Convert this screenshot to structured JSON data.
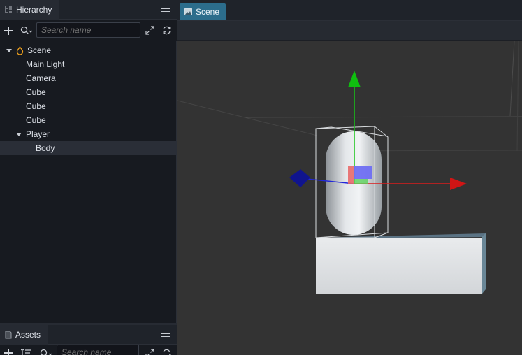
{
  "hierarchy": {
    "tab_label": "Hierarchy",
    "search_placeholder": "Search name",
    "tree": [
      {
        "label": "Scene",
        "depth": 0,
        "expanded": true,
        "icon": "scene-icon"
      },
      {
        "label": "Main Light",
        "depth": 1
      },
      {
        "label": "Camera",
        "depth": 1
      },
      {
        "label": "Cube",
        "depth": 1
      },
      {
        "label": "Cube",
        "depth": 1
      },
      {
        "label": "Cube",
        "depth": 1
      },
      {
        "label": "Player",
        "depth": 1,
        "expanded": true
      },
      {
        "label": "Body",
        "depth": 2,
        "selected": true
      }
    ]
  },
  "assets": {
    "tab_label": "Assets",
    "search_placeholder": "Search name"
  },
  "scene": {
    "tab_label": "Scene"
  },
  "colors": {
    "accent": "#2c6d8c",
    "gizmo_x": "#d11a1a",
    "gizmo_y": "#11c011",
    "gizmo_z": "#1a23b5",
    "viewport_bg": "#333333",
    "selected_row": "#2a2e37"
  }
}
